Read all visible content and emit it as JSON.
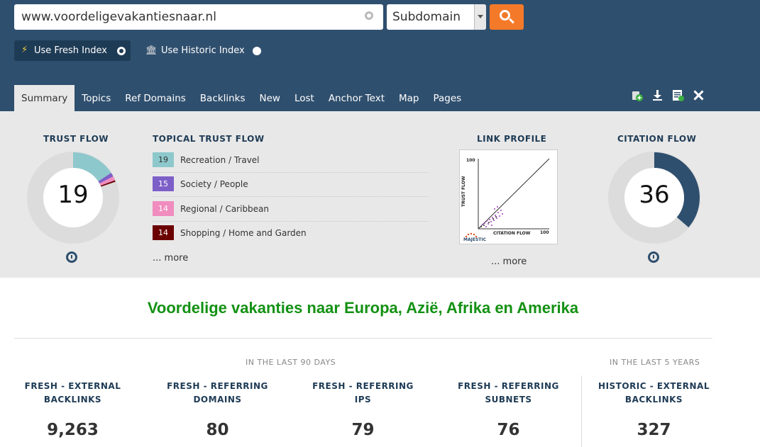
{
  "search": {
    "url": "www.voordeligevakantiesnaar.nl",
    "scope": "Subdomain",
    "settings_icon": "gear-icon",
    "search_icon": "search-icon"
  },
  "index": {
    "fresh_label": "Use Fresh Index",
    "historic_label": "Use Historic Index",
    "selected": "fresh"
  },
  "tabs": [
    {
      "label": "Summary",
      "active": true
    },
    {
      "label": "Topics"
    },
    {
      "label": "Ref Domains"
    },
    {
      "label": "Backlinks"
    },
    {
      "label": "New"
    },
    {
      "label": "Lost"
    },
    {
      "label": "Anchor Text"
    },
    {
      "label": "Map"
    },
    {
      "label": "Pages"
    }
  ],
  "tools": [
    "add-to-bucket-icon",
    "download-icon",
    "report-icon",
    "tools-icon"
  ],
  "trust_flow": {
    "title": "TRUST FLOW",
    "value": "19"
  },
  "citation_flow": {
    "title": "CITATION FLOW",
    "value": "36"
  },
  "topical": {
    "title": "TOPICAL TRUST FLOW",
    "items": [
      {
        "value": "19",
        "label": "Recreation / Travel",
        "color": "#8dc8cc"
      },
      {
        "value": "15",
        "label": "Society / People",
        "color": "#7d5fc8"
      },
      {
        "value": "14",
        "label": "Regional / Caribbean",
        "color": "#f08cbe"
      },
      {
        "value": "14",
        "label": "Shopping / Home and Garden",
        "color": "#6b0000"
      }
    ],
    "more": "... more"
  },
  "link_profile": {
    "title": "LINK PROFILE",
    "more": "... more",
    "y_label": "TRUST FLOW",
    "x_label": "CITATION FLOW",
    "max": "100",
    "logo_text": "MAJESTIC"
  },
  "site_title": "Voordelige vakanties naar Europa, Azië, Afrika en Amerika",
  "periods": {
    "fresh": "IN THE LAST 90 DAYS",
    "historic": "IN THE LAST 5 YEARS"
  },
  "metrics": [
    {
      "label1": "FRESH - EXTERNAL",
      "label2": "BACKLINKS",
      "value": "9,263"
    },
    {
      "label1": "FRESH - REFERRING",
      "label2": "DOMAINS",
      "value": "80"
    },
    {
      "label1": "FRESH - REFERRING",
      "label2": "IPS",
      "value": "79"
    },
    {
      "label1": "FRESH - REFERRING",
      "label2": "SUBNETS",
      "value": "76"
    },
    {
      "label1": "HISTORIC - EXTERNAL",
      "label2": "BACKLINKS",
      "value": "327"
    }
  ],
  "colors": {
    "header_bg": "#2f4f6e",
    "accent": "#f47a2a",
    "title_green": "#139113",
    "citation_flow_arc": "#2f4f6e"
  }
}
